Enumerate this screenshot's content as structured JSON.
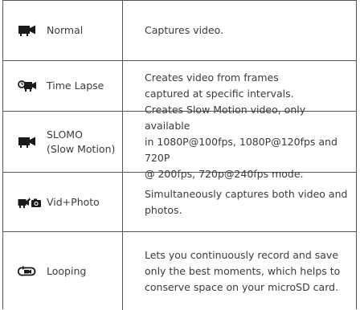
{
  "rows": [
    {
      "mode": "Normal",
      "icon": "video-camera-icon",
      "description": "Captures video."
    },
    {
      "mode": "Time Lapse",
      "icon": "timelapse-camera-icon",
      "description_lines": [
        "Creates video from frames",
        "captured at specific intervals."
      ]
    },
    {
      "mode_lines": [
        "SLOMO",
        "(Slow Motion)"
      ],
      "icon": "video-camera-icon",
      "description_lines": [
        "Creates Slow Motion video, only available",
        "in 1080P@100fps, 1080P@120fps and 720P",
        "@ 200fps, 720p@240fps mode."
      ]
    },
    {
      "mode": "Vid+Photo",
      "icon": "video-plus-photo-icon",
      "description_lines": [
        "Simultaneously captures both video and",
        "photos."
      ]
    },
    {
      "mode": "Looping",
      "icon": "looping-icon",
      "description_lines": [
        "Lets you continuously record and save",
        "only the best moments, which helps to",
        "conserve space on your microSD card."
      ]
    }
  ]
}
